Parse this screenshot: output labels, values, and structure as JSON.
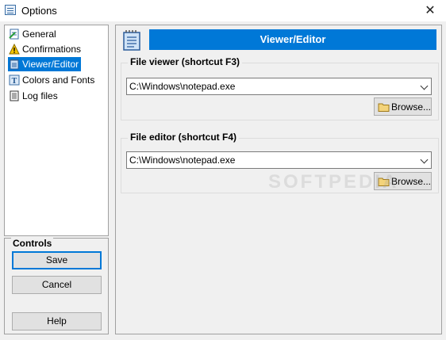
{
  "window": {
    "title": "Options",
    "close_glyph": "✕"
  },
  "sidebar": {
    "items": [
      {
        "label": "General",
        "icon": "general-settings-icon",
        "selected": false
      },
      {
        "label": "Confirmations",
        "icon": "warning-icon",
        "selected": false
      },
      {
        "label": "Viewer/Editor",
        "icon": "notepad-icon",
        "selected": true
      },
      {
        "label": "Colors and Fonts",
        "icon": "font-icon",
        "selected": false
      },
      {
        "label": "Log files",
        "icon": "log-file-icon",
        "selected": false
      }
    ]
  },
  "controls": {
    "title": "Controls",
    "save_label": "Save",
    "cancel_label": "Cancel",
    "help_label": "Help"
  },
  "main": {
    "header_title": "Viewer/Editor",
    "viewer": {
      "title": "File viewer (shortcut F3)",
      "value": "C:\\Windows\\notepad.exe",
      "browse_label": "Browse..."
    },
    "editor": {
      "title": "File editor (shortcut F4)",
      "value": "C:\\Windows\\notepad.exe",
      "browse_label": "Browse..."
    }
  },
  "watermark": "SOFTPEDIA",
  "colors": {
    "accent": "#0078d7",
    "background": "#f0f0f0"
  }
}
